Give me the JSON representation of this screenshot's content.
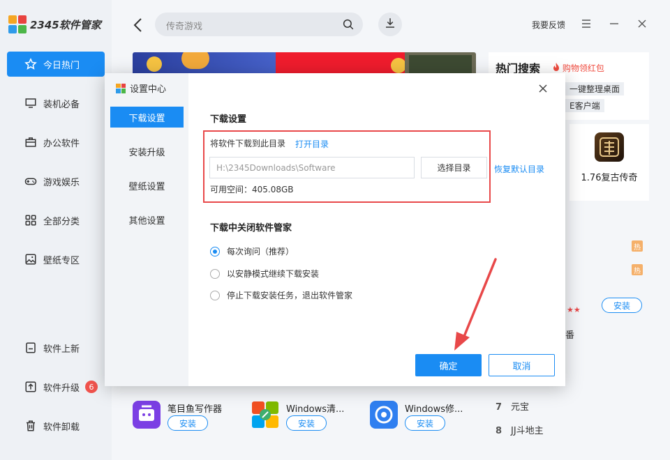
{
  "app": {
    "logo_text": "2345软件管家"
  },
  "sidebar": {
    "items": [
      {
        "label": "今日热门",
        "icon": "star-icon"
      },
      {
        "label": "装机必备",
        "icon": "monitor-icon"
      },
      {
        "label": "办公软件",
        "icon": "briefcase-icon"
      },
      {
        "label": "游戏娱乐",
        "icon": "gamepad-icon"
      },
      {
        "label": "全部分类",
        "icon": "grid-icon"
      },
      {
        "label": "壁纸专区",
        "icon": "image-icon"
      }
    ],
    "bottom": [
      {
        "label": "软件上新",
        "icon": "bookmark-icon"
      },
      {
        "label": "软件升级",
        "icon": "upload-icon",
        "badge": "6"
      },
      {
        "label": "软件卸载",
        "icon": "trash-icon"
      }
    ]
  },
  "header": {
    "search_placeholder": "传奇游戏",
    "feedback": "我要反馈"
  },
  "hot_search": {
    "title": "热门搜索",
    "subtitle": "购物领红包",
    "tags": [
      "一键整理桌面",
      "E客户端"
    ],
    "game_name": "1.76复古传奇",
    "hot_label": "热",
    "install_label": "安装",
    "partial_text": "番"
  },
  "apps": [
    {
      "name": "笔目鱼写作器",
      "install": "安装"
    },
    {
      "name": "Windows清...",
      "install": "安装"
    },
    {
      "name": "Windows修...",
      "install": "安装"
    }
  ],
  "ranking": [
    {
      "num": "7",
      "name": "元宝"
    },
    {
      "num": "8",
      "name": "JJ斗地主"
    }
  ],
  "dialog": {
    "title": "设置中心",
    "nav": [
      "下载设置",
      "安装升级",
      "壁纸设置",
      "其他设置"
    ],
    "section1_title": "下载设置",
    "download_to_label": "将软件下载到此目录",
    "open_dir": "打开目录",
    "path_value": "H:\\2345Downloads\\Software",
    "choose_dir": "选择目录",
    "restore_default": "恢复默认目录",
    "free_space": "可用空间：405.08GB",
    "section2_title": "下载中关闭软件管家",
    "options": [
      {
        "label": "每次询问（推荐）",
        "selected": true
      },
      {
        "label": "以安静模式继续下载安装",
        "selected": false
      },
      {
        "label": "停止下载安装任务，退出软件管家",
        "selected": false
      }
    ],
    "ok": "确定",
    "cancel": "取消"
  },
  "colors": {
    "accent": "#1a8cf3",
    "highlight_red": "#e84849",
    "badge_red": "#f0534d"
  }
}
